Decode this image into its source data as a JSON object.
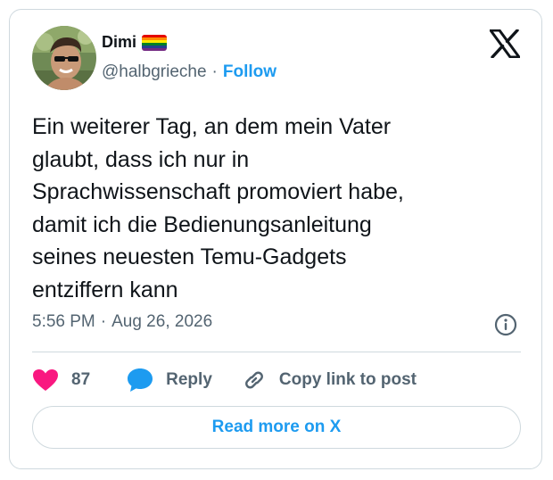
{
  "author": {
    "name": "Dimi",
    "handle": "@halbgrieche",
    "separator": "·",
    "follow_label": "Follow",
    "avatar_icon": "user-avatar",
    "flag_icon": "rainbow-flag-icon"
  },
  "tweet": {
    "text": "Ein weiterer Tag, an dem mein Vater\nglaubt, dass ich nur in\nSprachwissenschaft promoviert habe,\ndamit ich die Bedienungsanleitung\nseines neuesten Temu-Gadgets\nentziffern kann",
    "time": "5:56 PM",
    "separator": "·",
    "date": "Aug 26, 2026"
  },
  "actions": {
    "like_count": "87",
    "reply_label": "Reply",
    "copy_label": "Copy link to post"
  },
  "footer": {
    "read_more_label": "Read more on X"
  },
  "colors": {
    "accent": "#1d9bf0",
    "like": "#f91880",
    "text": "#0f1419",
    "muted": "#536471",
    "border": "#cfd9de"
  }
}
